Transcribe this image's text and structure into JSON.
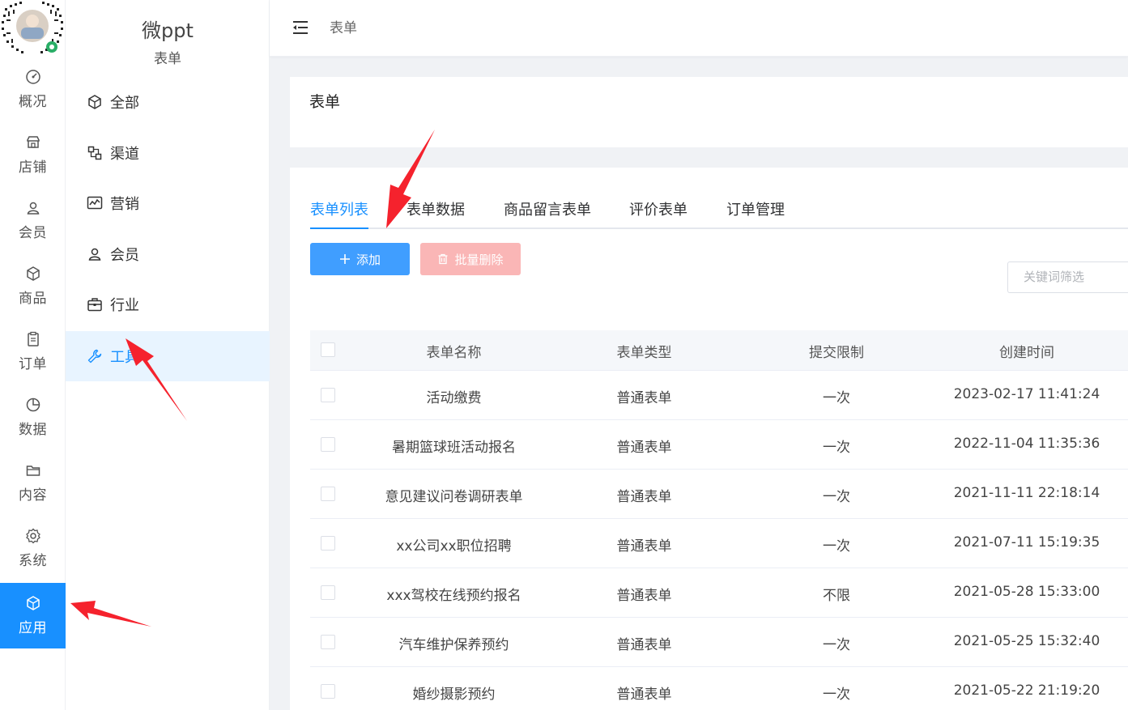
{
  "sidebar": {
    "items": [
      {
        "label": "概况",
        "icon": "dashboard-icon"
      },
      {
        "label": "店铺",
        "icon": "store-icon"
      },
      {
        "label": "会员",
        "icon": "user-icon"
      },
      {
        "label": "商品",
        "icon": "box-icon"
      },
      {
        "label": "订单",
        "icon": "clipboard-icon"
      },
      {
        "label": "数据",
        "icon": "pie-icon"
      },
      {
        "label": "内容",
        "icon": "folder-icon"
      },
      {
        "label": "系统",
        "icon": "gear-icon"
      },
      {
        "label": "应用",
        "icon": "cube-icon"
      }
    ],
    "active_index": 8
  },
  "submenu": {
    "brand": "微ppt",
    "subtitle": "表单",
    "items": [
      {
        "label": "全部",
        "icon": "cube-icon"
      },
      {
        "label": "渠道",
        "icon": "channel-icon"
      },
      {
        "label": "营销",
        "icon": "chart-icon"
      },
      {
        "label": "会员",
        "icon": "user-icon"
      },
      {
        "label": "行业",
        "icon": "briefcase-icon"
      },
      {
        "label": "工具",
        "icon": "wrench-icon"
      }
    ],
    "active_index": 5
  },
  "header": {
    "breadcrumb": "表单"
  },
  "page": {
    "title": "表单"
  },
  "tabs": [
    {
      "label": "表单列表"
    },
    {
      "label": "表单数据"
    },
    {
      "label": "商品留言表单"
    },
    {
      "label": "评价表单"
    },
    {
      "label": "订单管理"
    }
  ],
  "toolbar": {
    "add_label": "添加",
    "batch_delete_label": "批量删除",
    "search_placeholder": "关键词筛选"
  },
  "table": {
    "columns": [
      "表单名称",
      "表单类型",
      "提交限制",
      "创建时间"
    ],
    "rows": [
      [
        "活动缴费",
        "普通表单",
        "一次",
        "2023-02-17 11:41:24"
      ],
      [
        "暑期篮球班活动报名",
        "普通表单",
        "一次",
        "2022-11-04 11:35:36"
      ],
      [
        "意见建议问卷调研表单",
        "普通表单",
        "一次",
        "2021-11-11 22:18:14"
      ],
      [
        "xx公司xx职位招聘",
        "普通表单",
        "一次",
        "2021-07-11 15:19:35"
      ],
      [
        "xxx驾校在线预约报名",
        "普通表单",
        "不限",
        "2021-05-28 15:33:00"
      ],
      [
        "汽车维护保养预约",
        "普通表单",
        "一次",
        "2021-05-25 15:32:40"
      ],
      [
        "婚纱摄影预约",
        "普通表单",
        "一次",
        "2021-05-22 21:19:20"
      ]
    ]
  },
  "colors": {
    "primary": "#1890ff",
    "button_primary": "#409eff",
    "button_danger_disabled": "#fab6b6",
    "arrow": "#f5222d"
  }
}
